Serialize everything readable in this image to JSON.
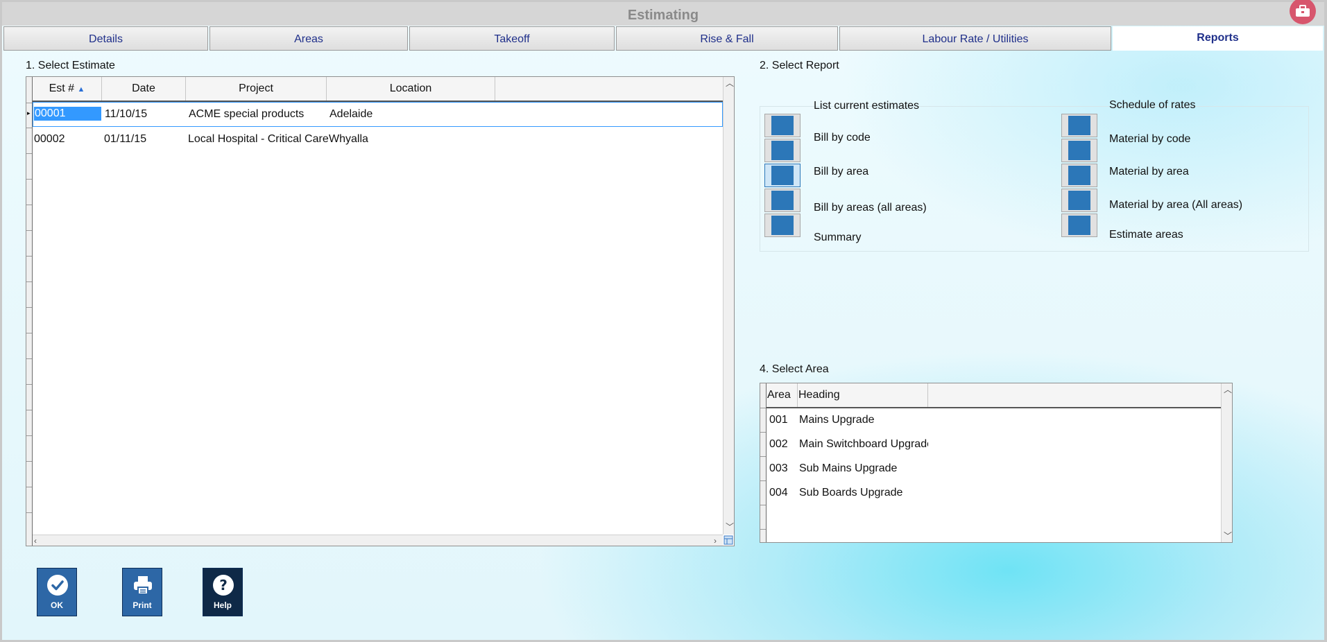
{
  "window": {
    "title": "Estimating"
  },
  "tabs": [
    {
      "label": "Details"
    },
    {
      "label": "Areas"
    },
    {
      "label": "Takeoff"
    },
    {
      "label": "Rise & Fall"
    },
    {
      "label": "Labour Rate / Utilities"
    },
    {
      "label": "Reports"
    }
  ],
  "active_tab": "Reports",
  "estimates": {
    "section_label": "1. Select Estimate",
    "columns": [
      "Est #",
      "Date",
      "Project",
      "Location"
    ],
    "sort_column": "Est #",
    "rows": [
      {
        "est": "00001",
        "date": "11/10/15",
        "project": "ACME special products",
        "location": "Adelaide"
      },
      {
        "est": "00002",
        "date": "01/11/15",
        "project": "Local Hospital - Critical Care",
        "location": "Whyalla"
      }
    ]
  },
  "reports": {
    "section_label": "2. Select Report",
    "left_heading": "List current estimates",
    "right_heading": "Schedule of rates",
    "left": [
      {
        "label": "Bill by code"
      },
      {
        "label": "Bill by area"
      },
      {
        "label": "Bill by areas (all areas)"
      },
      {
        "label": "Summary"
      }
    ],
    "right": [
      {
        "label": "Material by code"
      },
      {
        "label": "Material by area"
      },
      {
        "label": "Material by area (All areas)"
      },
      {
        "label": "Estimate areas"
      }
    ]
  },
  "areas": {
    "section_label": "4. Select Area",
    "columns": [
      "Area",
      "Heading"
    ],
    "rows": [
      {
        "area": "001",
        "heading": "Mains Upgrade"
      },
      {
        "area": "002",
        "heading": "Main Switchboard Upgrade"
      },
      {
        "area": "003",
        "heading": "Sub Mains Upgrade"
      },
      {
        "area": "004",
        "heading": "Sub Boards Upgrade"
      }
    ]
  },
  "buttons": {
    "ok": "OK",
    "print": "Print",
    "help": "Help"
  },
  "colors": {
    "tab_text": "#1f2f8a",
    "selection": "#3399ff",
    "report_button": "#2c77b8",
    "accent": "#d7566d"
  }
}
